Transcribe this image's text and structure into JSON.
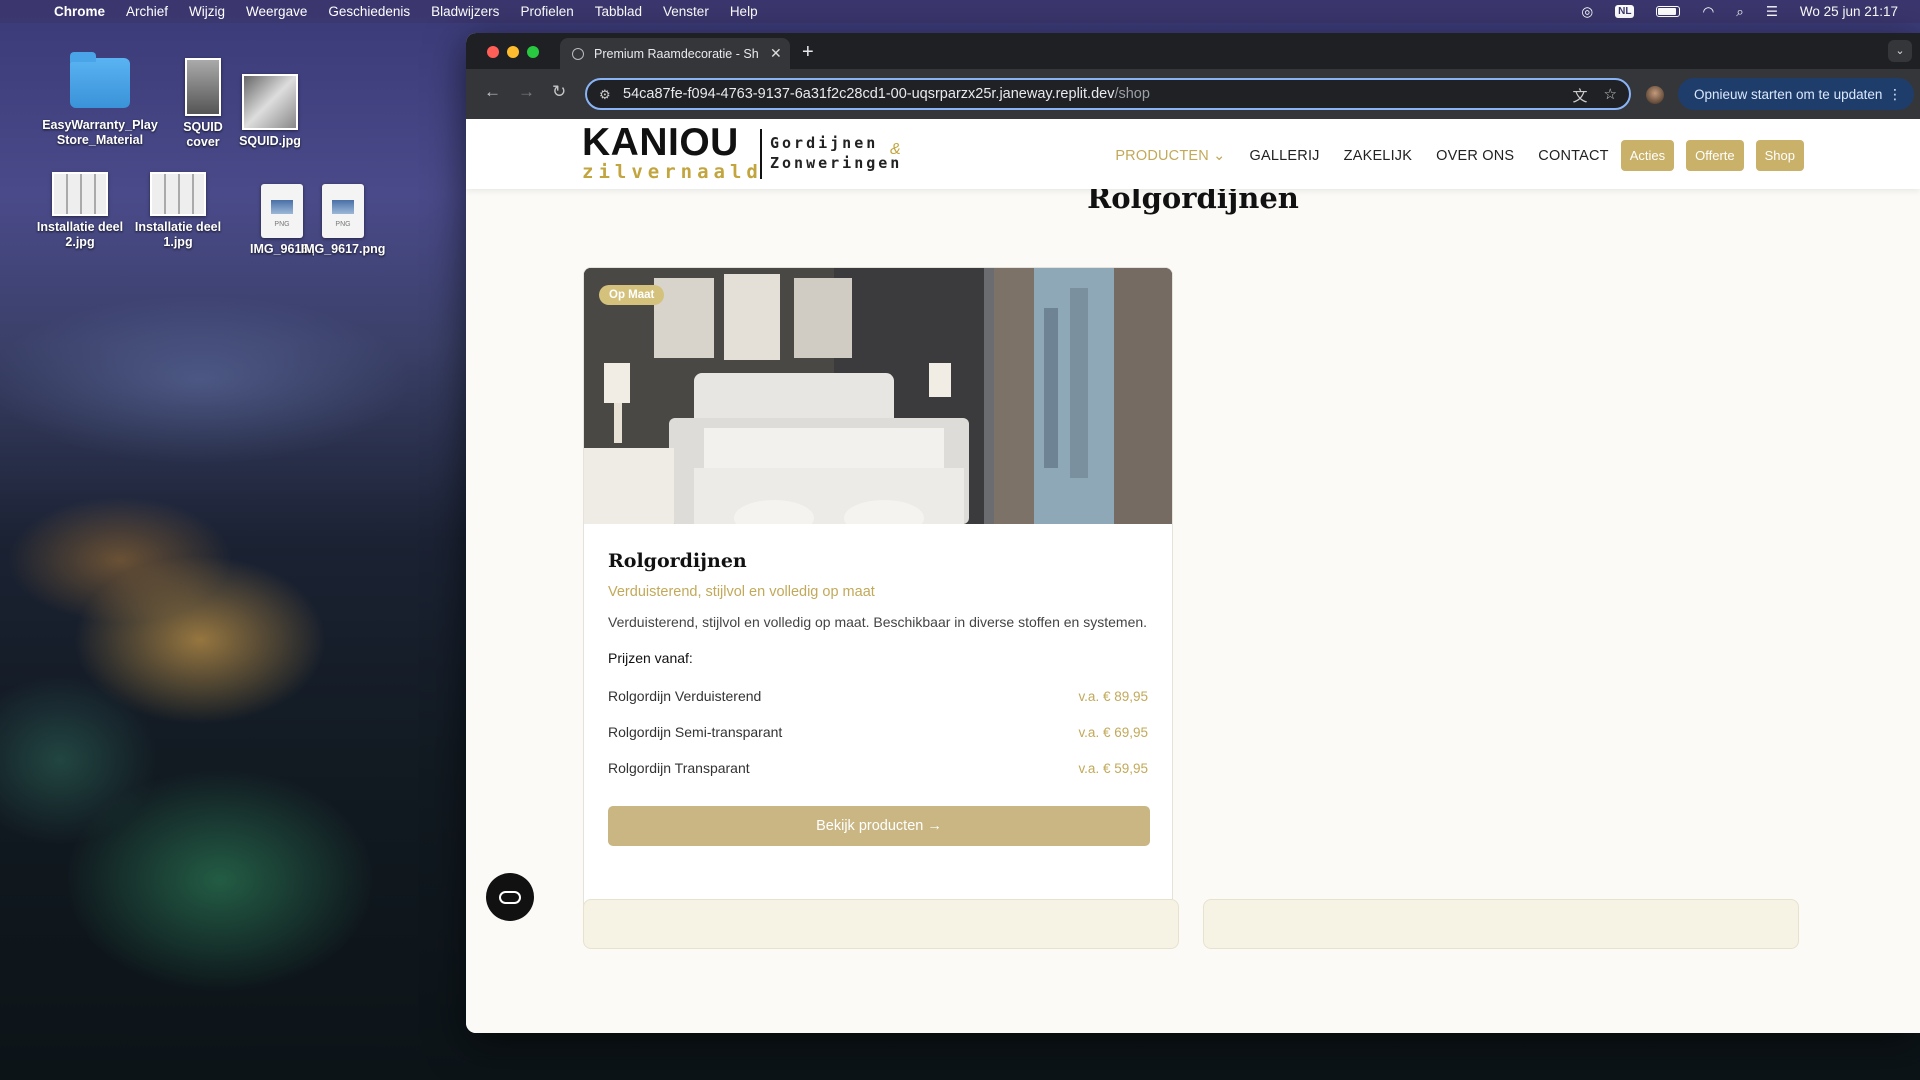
{
  "menubar": {
    "app": "Chrome",
    "items": [
      "Archief",
      "Wijzig",
      "Weergave",
      "Geschiedenis",
      "Bladwijzers",
      "Profielen",
      "Tabblad",
      "Venster",
      "Help"
    ],
    "input_source": "NL",
    "clock": "Wo 25 jun  21:17"
  },
  "desktop": {
    "icons": [
      {
        "label": "EasyWarranty_PlayStore_Material"
      },
      {
        "label": "SQUID cover"
      },
      {
        "label": "SQUID.jpg"
      },
      {
        "label": "Installatie deel 2.jpg"
      },
      {
        "label": "Installatie deel 1.jpg"
      },
      {
        "label": "IMG_9616.png"
      },
      {
        "label": "IMG_9617.png"
      }
    ]
  },
  "browser": {
    "tab_title": "Premium Raamdecoratie - Sh",
    "url_host": "54ca87fe-f094-4763-9137-6a31f2c28cd1-00-uqsrparzx25r.janeway.replit.dev",
    "url_path": "/shop",
    "update_button": "Opnieuw starten om te updaten"
  },
  "site": {
    "logo": {
      "brand": "KANIOU",
      "sub": "zilvernaald",
      "tag_line1": "Gordijnen",
      "tag_line2": "Zonweringen",
      "amp": "&"
    },
    "nav": [
      {
        "label": "PRODUCTEN ⌄",
        "active": true
      },
      {
        "label": "GALLERIJ"
      },
      {
        "label": "ZAKELIJK"
      },
      {
        "label": "OVER ONS"
      },
      {
        "label": "CONTACT"
      }
    ],
    "pills": [
      "Acties",
      "Offerte",
      "Shop"
    ],
    "page_title": "Rolgordijnen",
    "card": {
      "badge": "Op Maat",
      "title": "Rolgordijnen",
      "subtitle": "Verduisterend, stijlvol en volledig op maat",
      "description": "Verduisterend, stijlvol en volledig op maat. Beschikbaar in diverse stoffen en systemen.",
      "prices_heading": "Prijzen vanaf:",
      "prices": [
        {
          "name": "Rolgordijn Verduisterend",
          "price": "v.a. € 89,95"
        },
        {
          "name": "Rolgordijn Semi-transparant",
          "price": "v.a. € 69,95"
        },
        {
          "name": "Rolgordijn Transparant",
          "price": "v.a. € 59,95"
        }
      ],
      "cta": "Bekijk producten  →"
    }
  },
  "colors": {
    "gold": "#c2a95a",
    "pill": "#c9b16a",
    "cta": "#c9b683"
  }
}
